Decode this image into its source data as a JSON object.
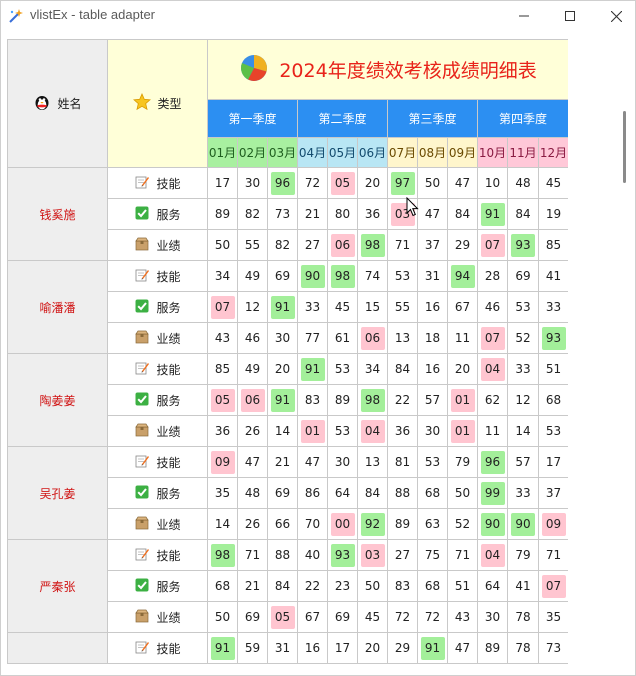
{
  "window": {
    "title": "vlistEx - table adapter"
  },
  "header": {
    "name_label": "姓名",
    "type_label": "类型",
    "table_title": "2024年度绩效考核成绩明细表",
    "quarters": [
      "第一季度",
      "第二季度",
      "第三季度",
      "第四季度"
    ],
    "months": [
      "01月",
      "02月",
      "03月",
      "04月",
      "05月",
      "06月",
      "07月",
      "08月",
      "09月",
      "10月",
      "11月",
      "12月"
    ]
  },
  "categories": [
    "技能",
    "服务",
    "业绩"
  ],
  "rows": [
    {
      "name": "钱奚施",
      "scores": [
        [
          "17",
          "30",
          "96",
          "72",
          "05",
          "20",
          "97",
          "50",
          "47",
          "10",
          "48",
          "45"
        ],
        [
          "89",
          "82",
          "73",
          "21",
          "80",
          "36",
          "03",
          "47",
          "84",
          "91",
          "84",
          "19"
        ],
        [
          "50",
          "55",
          "82",
          "27",
          "06",
          "98",
          "71",
          "37",
          "29",
          "07",
          "93",
          "85"
        ]
      ]
    },
    {
      "name": "喻潘潘",
      "scores": [
        [
          "34",
          "49",
          "69",
          "90",
          "98",
          "74",
          "53",
          "31",
          "94",
          "28",
          "69",
          "41"
        ],
        [
          "07",
          "12",
          "91",
          "33",
          "45",
          "15",
          "55",
          "16",
          "67",
          "46",
          "53",
          "33"
        ],
        [
          "43",
          "46",
          "30",
          "77",
          "61",
          "06",
          "13",
          "18",
          "11",
          "07",
          "52",
          "93"
        ]
      ]
    },
    {
      "name": "陶姜姜",
      "scores": [
        [
          "85",
          "49",
          "20",
          "91",
          "53",
          "34",
          "84",
          "16",
          "20",
          "04",
          "33",
          "51"
        ],
        [
          "05",
          "06",
          "91",
          "83",
          "89",
          "98",
          "22",
          "57",
          "01",
          "62",
          "12",
          "68"
        ],
        [
          "36",
          "26",
          "14",
          "01",
          "53",
          "04",
          "36",
          "30",
          "01",
          "11",
          "14",
          "53"
        ]
      ]
    },
    {
      "name": "吴孔姜",
      "scores": [
        [
          "09",
          "47",
          "21",
          "47",
          "30",
          "13",
          "81",
          "53",
          "79",
          "96",
          "57",
          "17"
        ],
        [
          "35",
          "48",
          "69",
          "86",
          "64",
          "84",
          "88",
          "68",
          "50",
          "99",
          "33",
          "37"
        ],
        [
          "14",
          "26",
          "66",
          "70",
          "00",
          "92",
          "89",
          "63",
          "52",
          "90",
          "90",
          "09"
        ]
      ]
    },
    {
      "name": "严秦张",
      "scores": [
        [
          "98",
          "71",
          "88",
          "40",
          "93",
          "03",
          "27",
          "75",
          "71",
          "04",
          "79",
          "71"
        ],
        [
          "68",
          "21",
          "84",
          "22",
          "23",
          "50",
          "83",
          "68",
          "51",
          "64",
          "41",
          "07"
        ],
        [
          "50",
          "69",
          "05",
          "67",
          "69",
          "45",
          "72",
          "72",
          "43",
          "30",
          "78",
          "35"
        ]
      ]
    },
    {
      "name": "",
      "scores": [
        [
          "91",
          "59",
          "31",
          "16",
          "17",
          "20",
          "29",
          "91",
          "47",
          "89",
          "78",
          "73"
        ]
      ]
    }
  ],
  "colors": {
    "high": "#a3ef9a",
    "low": "#ffc5d0",
    "quarter_header": "#2c8ff2",
    "title_text": "#e8231a",
    "name_text": "#d01414"
  },
  "icons": {
    "app": "wand-icon",
    "name_header": "penguin-icon",
    "type_header": "star-icon",
    "title": "pie-chart-icon",
    "skill": "pencil-paper-icon",
    "service": "green-check-icon",
    "performance": "box-icon"
  }
}
